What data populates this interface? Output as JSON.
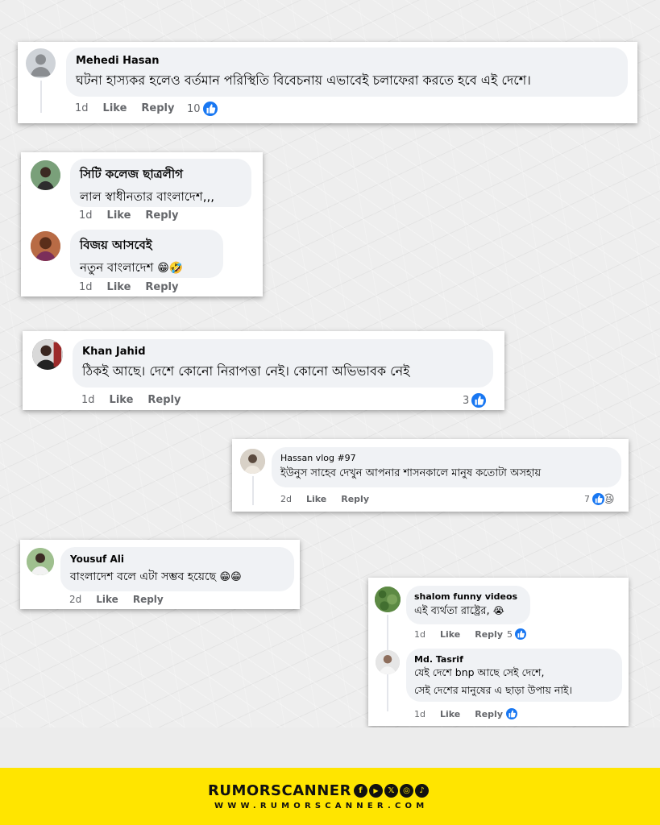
{
  "colors": {
    "like_blue": "#1877f2",
    "bubble_bg": "#f0f2f5",
    "meta_gray": "#65676b",
    "brand_yellow": "#ffe500"
  },
  "comments": [
    {
      "name": "Mehedi Hasan",
      "text": "ঘটনা হাস্যকর হলেও বর্তমান পরিস্থিতি বিবেচনায় এভাবেই চলাফেরা করতে হবে এই দেশে।",
      "time": "1d",
      "like": "Like",
      "reply": "Reply",
      "reaction_count": "10",
      "reaction_icons": [
        "like-icon"
      ]
    },
    {
      "name": "সিটি কলেজ ছাত্রলীগ",
      "text": "লাল স্বাধীনতার বাংলাদেশ,,,",
      "time": "1d",
      "like": "Like",
      "reply": "Reply"
    },
    {
      "name": "বিজয় আসবেই",
      "text": "নতুন বাংলাদেশ",
      "emojis": "😁🤣",
      "time": "1d",
      "like": "Like",
      "reply": "Reply"
    },
    {
      "name": "Khan Jahid",
      "text": "ঠিকই আছে। দেশে কোনো নিরাপত্তা নেই। কোনো অভিভাবক নেই",
      "time": "1d",
      "like": "Like",
      "reply": "Reply",
      "reaction_count": "3",
      "reaction_icons": [
        "like-icon"
      ]
    },
    {
      "name": "Hassan vlog #97",
      "text": "ইউনুস সাহেব দেখুন আপনার শাসনকালে মানুষ কতোটা অসহায়",
      "time": "2d",
      "like": "Like",
      "reply": "Reply",
      "reaction_count": "7",
      "reaction_icons": [
        "like-icon",
        "haha-icon"
      ],
      "haha_emoji": "😆"
    },
    {
      "name": "Yousuf Ali",
      "text": "বাংলাদেশ বলে এটা সম্ভব হয়েছে",
      "emojis": "😁😁",
      "time": "2d",
      "like": "Like",
      "reply": "Reply"
    },
    {
      "name": "shalom funny videos",
      "text": "এই ব্যর্থতা রাষ্ট্রের,",
      "emojis": "😭",
      "time": "1d",
      "like": "Like",
      "reply": "Reply",
      "reaction_count": "5",
      "reaction_icons": [
        "like-icon"
      ]
    },
    {
      "name": "Md. Tasrif",
      "text_line1": "যেই দেশে bnp আছে সেই দেশে,",
      "text_line2": "সেই দেশের মানুষের এ ছাড়া উপায় নাই।",
      "time": "1d",
      "like": "Like",
      "reply": "Reply",
      "reaction_icons": [
        "like-icon"
      ]
    }
  ],
  "footer": {
    "brand_name": "RUMORSCANNER",
    "url": "WWW.RUMORSCANNER.COM",
    "social_icons": [
      {
        "name": "facebook-icon",
        "glyph": "f"
      },
      {
        "name": "youtube-icon",
        "glyph": "▶"
      },
      {
        "name": "x-icon",
        "glyph": "𝕏"
      },
      {
        "name": "instagram-icon",
        "glyph": "◎"
      },
      {
        "name": "tiktok-icon",
        "glyph": "♪"
      }
    ]
  }
}
